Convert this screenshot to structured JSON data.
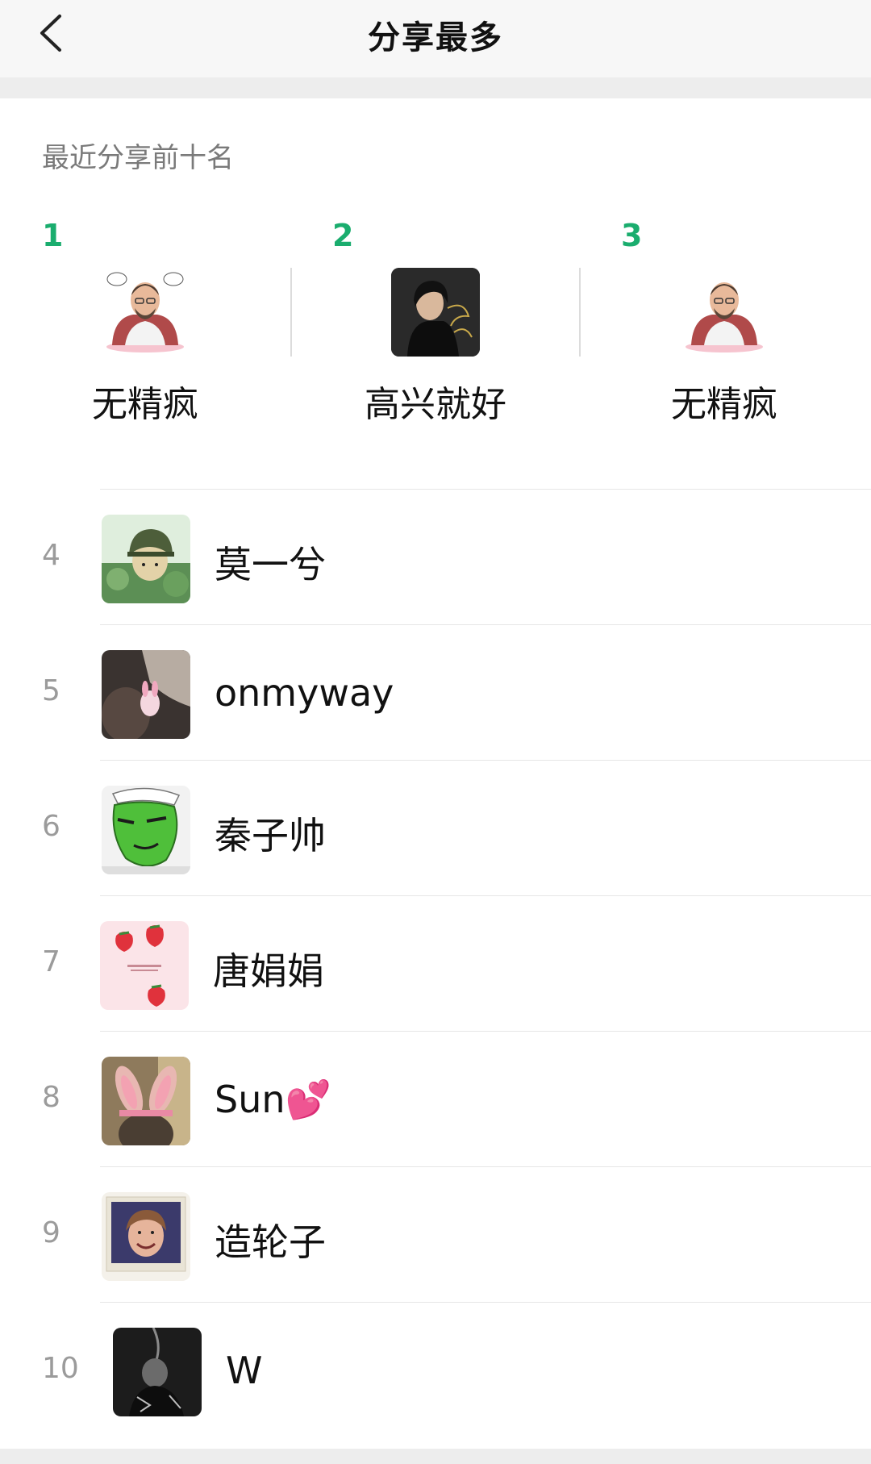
{
  "header": {
    "title": "分享最多"
  },
  "section": {
    "title": "最近分享前十名"
  },
  "top3": [
    {
      "rank": "1",
      "name": "无精疯",
      "avatar_icon": "cartoon-man-avatar"
    },
    {
      "rank": "2",
      "name": "高兴就好",
      "avatar_icon": "photo-portrait-avatar"
    },
    {
      "rank": "3",
      "name": "无精疯",
      "avatar_icon": "cartoon-man-avatar"
    }
  ],
  "list": [
    {
      "rank": "4",
      "name": "莫一兮",
      "avatar_icon": "soldier-avatar"
    },
    {
      "rank": "5",
      "name": "onmyway",
      "avatar_icon": "car-interior-avatar"
    },
    {
      "rank": "6",
      "name": "秦子帅",
      "avatar_icon": "green-alien-avatar"
    },
    {
      "rank": "7",
      "name": "唐娟娟",
      "avatar_icon": "strawberry-avatar"
    },
    {
      "rank": "8",
      "name": "Sun💕",
      "avatar_icon": "bunny-ears-avatar"
    },
    {
      "rank": "9",
      "name": "造轮子",
      "avatar_icon": "child-photo-avatar"
    },
    {
      "rank": "10",
      "name": "W",
      "avatar_icon": "dark-photo-avatar"
    }
  ],
  "colors": {
    "accent": "#1aad6e",
    "navbar_bg": "#f7f7f7",
    "divider": "#e6e6e6",
    "rank_gray": "#9b9b9b"
  }
}
